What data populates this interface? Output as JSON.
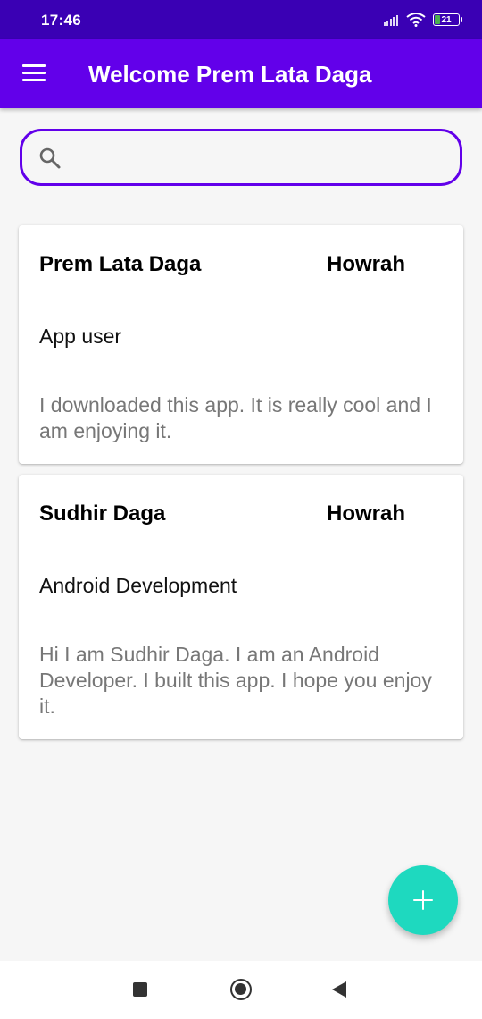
{
  "status_bar": {
    "time": "17:46",
    "battery_level": "21"
  },
  "app_bar": {
    "title": "Welcome Prem Lata Daga",
    "menu_icon": "hamburger-menu-icon"
  },
  "search": {
    "icon": "search-icon",
    "value": "",
    "placeholder": ""
  },
  "cards": [
    {
      "name": "Prem Lata Daga",
      "city": "Howrah",
      "role": "App user",
      "description": "I downloaded this app. It is really cool and I am enjoying it."
    },
    {
      "name": "Sudhir Daga",
      "city": "Howrah",
      "role": "Android Development",
      "description": "Hi I am Sudhir Daga. I am an Android Developer. I built this app. I hope you enjoy it."
    }
  ],
  "fab": {
    "icon": "plus-icon"
  },
  "nav_bar": {
    "icons": [
      "recents-square-icon",
      "home-circle-icon",
      "back-triangle-icon"
    ]
  },
  "colors": {
    "status_bar": "#3a00b4",
    "app_bar": "#6200ea",
    "search_border": "#6200ea",
    "fab": "#1ed9bf",
    "background": "#f6f6f6"
  }
}
